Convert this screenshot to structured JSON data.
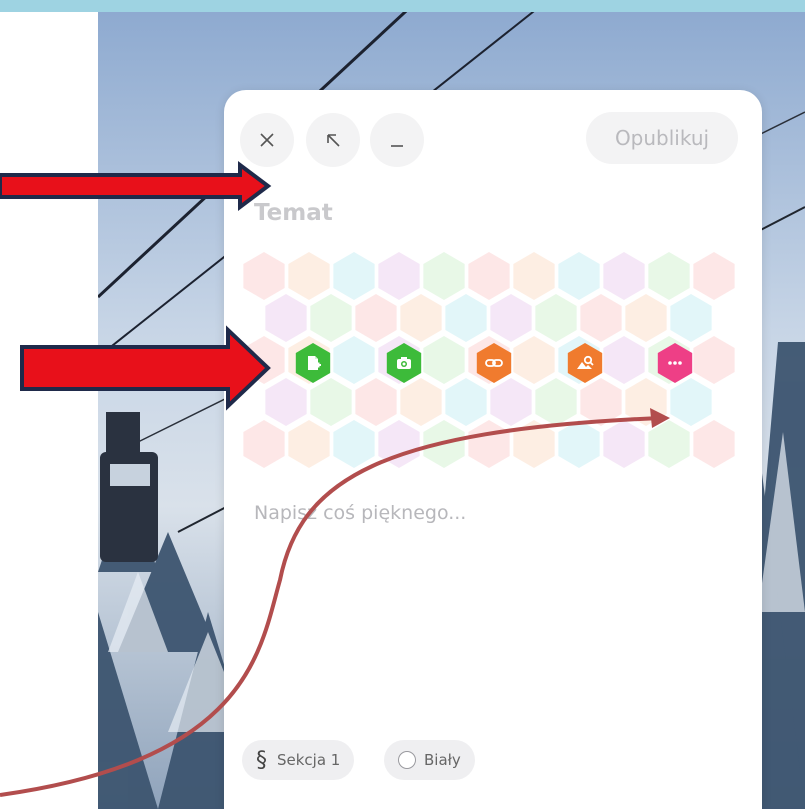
{
  "editor": {
    "close_icon": "close-icon",
    "expand_icon": "expand-arrow-icon",
    "minimize_icon": "minimize-icon",
    "publish_label": "Opublikuj",
    "subject_placeholder": "Temat",
    "body_placeholder": "Napisz coś pięknego...",
    "actions": [
      {
        "name": "add-file",
        "color": "#3dbb3a",
        "icon": "file-add-icon"
      },
      {
        "name": "camera",
        "color": "#3dbb3a",
        "icon": "camera-icon"
      },
      {
        "name": "link",
        "color": "#f07b2e",
        "icon": "link-icon"
      },
      {
        "name": "image-search",
        "color": "#f07b2e",
        "icon": "image-search-icon"
      },
      {
        "name": "more",
        "color": "#ee3f86",
        "icon": "more-icon"
      }
    ],
    "footer": {
      "section_label": "Sekcja 1",
      "background_label": "Biały"
    }
  },
  "annotations": {
    "arrow_color_fill": "#e8101a",
    "arrow_color_border": "#1f2a4a",
    "curve_color": "#b24d4d"
  }
}
